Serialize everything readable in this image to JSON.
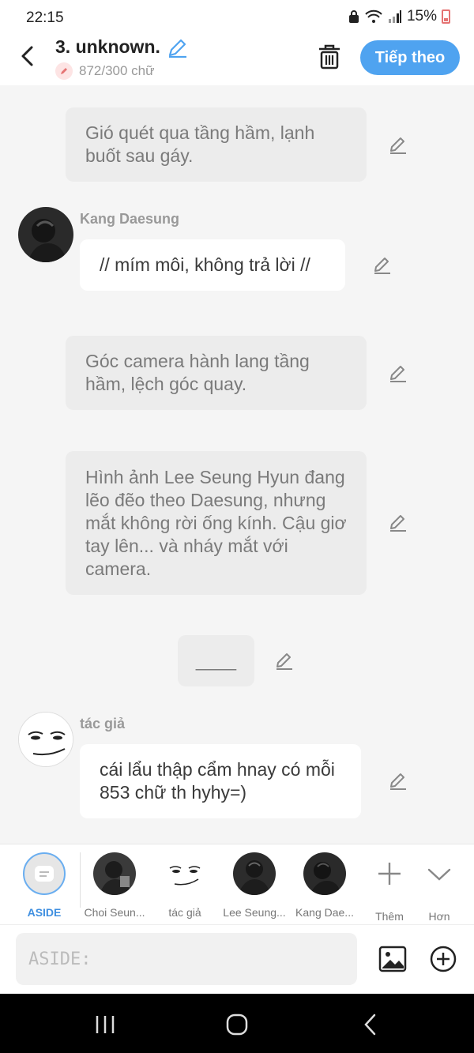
{
  "status": {
    "time": "22:15",
    "battery": "15%"
  },
  "header": {
    "title": "3. unknown.",
    "word_count": "872/300 chữ",
    "next_label": "Tiếp theo"
  },
  "messages": [
    {
      "type": "narration",
      "text": "Gió quét qua tầng hầm, lạnh buốt sau gáy."
    },
    {
      "type": "speech",
      "speaker": "Kang Daesung",
      "text": "// mím môi, không trả lời //"
    },
    {
      "type": "narration",
      "text": "Góc camera hành lang tầng hầm, lệch góc quay."
    },
    {
      "type": "narration",
      "text": "Hình ảnh Lee Seung Hyun đang lẽo đẽo theo Daesung, nhưng mắt không rời ống kính. Cậu giơ tay lên... và nháy mắt với camera."
    },
    {
      "type": "narration",
      "text": "____"
    },
    {
      "type": "speech",
      "speaker": "tác giả",
      "text": "cái lẩu thập cẩm hnay có mỗi 853 chữ th hyhy=)"
    }
  ],
  "character_bar": {
    "items": [
      {
        "label": "ASIDE",
        "icon": "aside-icon"
      },
      {
        "label": "Choi Seun..."
      },
      {
        "label": "tác giả"
      },
      {
        "label": "Lee Seung..."
      },
      {
        "label": "Kang Dae..."
      }
    ],
    "more_label": "Thêm",
    "expand_label": "Hơn"
  },
  "input": {
    "placeholder": "ASIDE:"
  },
  "colors": {
    "accent": "#4fa3f0",
    "narration_bg": "#ececec",
    "speech_bg": "#ffffff",
    "pencil_badge": "#e57373"
  }
}
